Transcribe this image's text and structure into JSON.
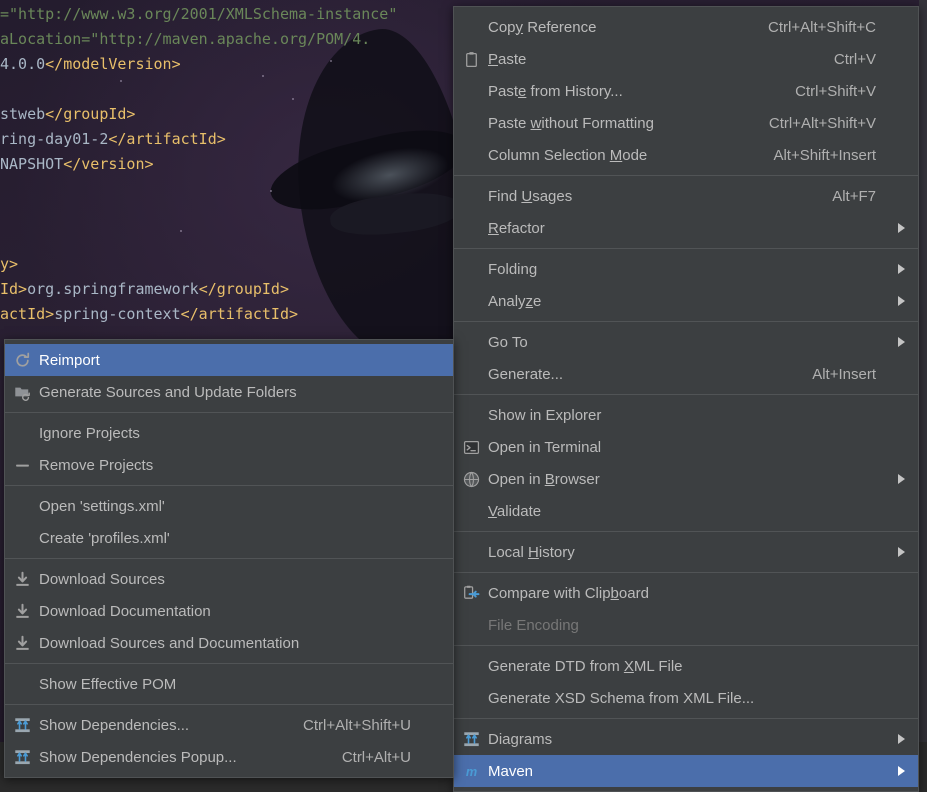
{
  "editor": {
    "code_lines": [
      {
        "segments": [
          {
            "text": "=\"http://www.w3.org/2001/XMLSchema-instance\"",
            "cls": "str"
          }
        ]
      },
      {
        "segments": [
          {
            "text": "aLocation=\"http://maven.apache.org/POM/4.",
            "cls": "str"
          }
        ]
      },
      {
        "segments": [
          {
            "text": "4.0.0",
            "cls": "txt"
          },
          {
            "text": "</modelVersion>",
            "cls": "tag"
          }
        ]
      },
      {
        "segments": [
          {
            "text": "",
            "cls": "txt"
          }
        ]
      },
      {
        "segments": [
          {
            "text": "stweb",
            "cls": "txt"
          },
          {
            "text": "</groupId>",
            "cls": "tag"
          }
        ]
      },
      {
        "segments": [
          {
            "text": "ring-day01-2",
            "cls": "txt"
          },
          {
            "text": "</artifactId>",
            "cls": "tag"
          }
        ]
      },
      {
        "segments": [
          {
            "text": "NAPSHOT",
            "cls": "txt"
          },
          {
            "text": "</version>",
            "cls": "tag"
          }
        ]
      },
      {
        "segments": [
          {
            "text": "",
            "cls": "txt"
          }
        ]
      },
      {
        "segments": [
          {
            "text": "",
            "cls": "txt"
          }
        ]
      },
      {
        "segments": [
          {
            "text": "",
            "cls": "txt"
          }
        ]
      },
      {
        "segments": [
          {
            "text": "y>",
            "cls": "tag"
          }
        ]
      },
      {
        "segments": [
          {
            "text": "Id>",
            "cls": "tag"
          },
          {
            "text": "org.springframework",
            "cls": "txt"
          },
          {
            "text": "</groupId>",
            "cls": "tag"
          }
        ]
      },
      {
        "segments": [
          {
            "text": "actId>",
            "cls": "tag"
          },
          {
            "text": "spring-context",
            "cls": "txt"
          },
          {
            "text": "</artifactId>",
            "cls": "tag"
          }
        ]
      }
    ]
  },
  "context_menu": {
    "name": "editor-context-menu",
    "groups": [
      {
        "items": [
          {
            "label_pre": "Cop",
            "mnemonic": "y",
            "label_post": " Reference",
            "accel": "Ctrl+Alt+Shift+C",
            "icon": "none",
            "submenu": false,
            "disabled": false,
            "selected": false
          },
          {
            "label_pre": "",
            "mnemonic": "P",
            "label_post": "aste",
            "accel": "Ctrl+V",
            "icon": "paste-icon",
            "submenu": false,
            "disabled": false,
            "selected": false
          },
          {
            "label_pre": "Past",
            "mnemonic": "e",
            "label_post": " from History...",
            "accel": "Ctrl+Shift+V",
            "icon": "none",
            "submenu": false,
            "disabled": false,
            "selected": false
          },
          {
            "label_pre": "Paste ",
            "mnemonic": "w",
            "label_post": "ithout Formatting",
            "accel": "Ctrl+Alt+Shift+V",
            "icon": "none",
            "submenu": false,
            "disabled": false,
            "selected": false
          },
          {
            "label_pre": "Column Selection ",
            "mnemonic": "M",
            "label_post": "ode",
            "accel": "Alt+Shift+Insert",
            "icon": "none",
            "submenu": false,
            "disabled": false,
            "selected": false
          }
        ]
      },
      {
        "items": [
          {
            "label_pre": "Find ",
            "mnemonic": "U",
            "label_post": "sages",
            "accel": "Alt+F7",
            "icon": "none",
            "submenu": false,
            "disabled": false,
            "selected": false
          },
          {
            "label_pre": "",
            "mnemonic": "R",
            "label_post": "efactor",
            "accel": "",
            "icon": "none",
            "submenu": true,
            "disabled": false,
            "selected": false
          }
        ]
      },
      {
        "items": [
          {
            "label_pre": "Folding",
            "mnemonic": "",
            "label_post": "",
            "accel": "",
            "icon": "none",
            "submenu": true,
            "disabled": false,
            "selected": false
          },
          {
            "label_pre": "Analy",
            "mnemonic": "z",
            "label_post": "e",
            "accel": "",
            "icon": "none",
            "submenu": true,
            "disabled": false,
            "selected": false
          }
        ]
      },
      {
        "items": [
          {
            "label_pre": "Go To",
            "mnemonic": "",
            "label_post": "",
            "accel": "",
            "icon": "none",
            "submenu": true,
            "disabled": false,
            "selected": false
          },
          {
            "label_pre": "Generate...",
            "mnemonic": "",
            "label_post": "",
            "accel": "Alt+Insert",
            "icon": "none",
            "submenu": false,
            "disabled": false,
            "selected": false
          }
        ]
      },
      {
        "items": [
          {
            "label_pre": "Show in Explorer",
            "mnemonic": "",
            "label_post": "",
            "accel": "",
            "icon": "none",
            "submenu": false,
            "disabled": false,
            "selected": false
          },
          {
            "label_pre": "Open in Terminal",
            "mnemonic": "",
            "label_post": "",
            "accel": "",
            "icon": "terminal-icon",
            "submenu": false,
            "disabled": false,
            "selected": false
          },
          {
            "label_pre": "Open in ",
            "mnemonic": "B",
            "label_post": "rowser",
            "accel": "",
            "icon": "browser-globe-icon",
            "submenu": true,
            "disabled": false,
            "selected": false
          },
          {
            "label_pre": "",
            "mnemonic": "V",
            "label_post": "alidate",
            "accel": "",
            "icon": "none",
            "submenu": false,
            "disabled": false,
            "selected": false
          }
        ]
      },
      {
        "items": [
          {
            "label_pre": "Local ",
            "mnemonic": "H",
            "label_post": "istory",
            "accel": "",
            "icon": "none",
            "submenu": true,
            "disabled": false,
            "selected": false
          }
        ]
      },
      {
        "items": [
          {
            "label_pre": "Compare with Clip",
            "mnemonic": "b",
            "label_post": "oard",
            "accel": "",
            "icon": "compare-clipboard-icon",
            "submenu": false,
            "disabled": false,
            "selected": false
          },
          {
            "label_pre": "File Encoding",
            "mnemonic": "",
            "label_post": "",
            "accel": "",
            "icon": "none",
            "submenu": false,
            "disabled": true,
            "selected": false
          }
        ]
      },
      {
        "items": [
          {
            "label_pre": "Generate DTD from ",
            "mnemonic": "X",
            "label_post": "ML File",
            "accel": "",
            "icon": "none",
            "submenu": false,
            "disabled": false,
            "selected": false
          },
          {
            "label_pre": "Generate XSD Schema from XML File...",
            "mnemonic": "",
            "label_post": "",
            "accel": "",
            "icon": "none",
            "submenu": false,
            "disabled": false,
            "selected": false
          }
        ]
      },
      {
        "items": [
          {
            "label_pre": "Diagrams",
            "mnemonic": "",
            "label_post": "",
            "accel": "",
            "icon": "diagram-icon",
            "submenu": true,
            "disabled": false,
            "selected": false
          },
          {
            "label_pre": "Maven",
            "mnemonic": "",
            "label_post": "",
            "accel": "",
            "icon": "maven-icon",
            "submenu": true,
            "disabled": false,
            "selected": true
          }
        ]
      }
    ]
  },
  "maven_submenu": {
    "name": "maven-submenu",
    "groups": [
      {
        "items": [
          {
            "label_pre": "Reimport",
            "mnemonic": "",
            "label_post": "",
            "accel": "",
            "icon": "refresh-icon",
            "submenu": false,
            "disabled": false,
            "selected": true
          },
          {
            "label_pre": "Generate Sources and Update Folders",
            "mnemonic": "",
            "label_post": "",
            "accel": "",
            "icon": "folder-refresh-icon",
            "submenu": false,
            "disabled": false,
            "selected": false
          }
        ]
      },
      {
        "items": [
          {
            "label_pre": "Ignore Projects",
            "mnemonic": "",
            "label_post": "",
            "accel": "",
            "icon": "none",
            "submenu": false,
            "disabled": false,
            "selected": false
          },
          {
            "label_pre": "Remove Projects",
            "mnemonic": "",
            "label_post": "",
            "accel": "",
            "icon": "minus-icon",
            "submenu": false,
            "disabled": false,
            "selected": false
          }
        ]
      },
      {
        "items": [
          {
            "label_pre": "Open 'settings.xml'",
            "mnemonic": "",
            "label_post": "",
            "accel": "",
            "icon": "none",
            "submenu": false,
            "disabled": false,
            "selected": false
          },
          {
            "label_pre": "Create 'profiles.xml'",
            "mnemonic": "",
            "label_post": "",
            "accel": "",
            "icon": "none",
            "submenu": false,
            "disabled": false,
            "selected": false
          }
        ]
      },
      {
        "items": [
          {
            "label_pre": "Download Sources",
            "mnemonic": "",
            "label_post": "",
            "accel": "",
            "icon": "download-icon",
            "submenu": false,
            "disabled": false,
            "selected": false
          },
          {
            "label_pre": "Download Documentation",
            "mnemonic": "",
            "label_post": "",
            "accel": "",
            "icon": "download-icon",
            "submenu": false,
            "disabled": false,
            "selected": false
          },
          {
            "label_pre": "Download Sources and Documentation",
            "mnemonic": "",
            "label_post": "",
            "accel": "",
            "icon": "download-icon",
            "submenu": false,
            "disabled": false,
            "selected": false
          }
        ]
      },
      {
        "items": [
          {
            "label_pre": "Show Effective POM",
            "mnemonic": "",
            "label_post": "",
            "accel": "",
            "icon": "none",
            "submenu": false,
            "disabled": false,
            "selected": false
          }
        ]
      },
      {
        "items": [
          {
            "label_pre": "Show Dependencies...",
            "mnemonic": "",
            "label_post": "",
            "accel": "Ctrl+Alt+Shift+U",
            "icon": "diagram-icon",
            "submenu": false,
            "disabled": false,
            "selected": false
          },
          {
            "label_pre": "Show Dependencies Popup...",
            "mnemonic": "",
            "label_post": "",
            "accel": "Ctrl+Alt+U",
            "icon": "diagram-icon",
            "submenu": false,
            "disabled": false,
            "selected": false
          }
        ]
      }
    ]
  },
  "colors": {
    "menu_background": "#3c3f41",
    "menu_border": "#4f5254",
    "selection_blue": "#4b6eab",
    "text": "#bbbbbb",
    "disabled_text": "#777777",
    "separator": "#515456",
    "accent_icon_blue": "#4a9bd5"
  }
}
